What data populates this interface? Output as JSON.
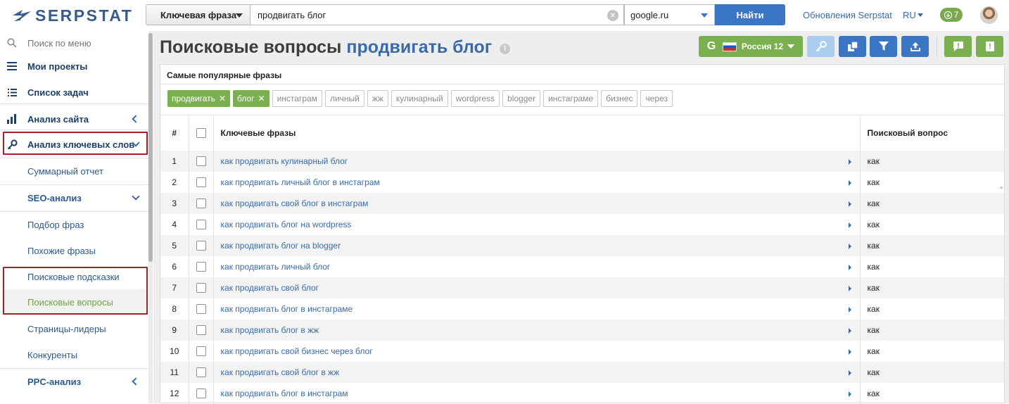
{
  "brand": {
    "name": "SERPSTAT"
  },
  "search": {
    "type_label": "Ключевая фраза",
    "query": "продвигать блог",
    "domain": "google.ru",
    "find_label": "Найти"
  },
  "header": {
    "updates_label": "Обновления Serpstat",
    "lang_label": "RU",
    "downloads_count": "7"
  },
  "sidebar": {
    "search_placeholder": "Поиск по меню",
    "items": [
      {
        "label": "Мои проекты"
      },
      {
        "label": "Список задач"
      },
      {
        "label": "Анализ сайта"
      },
      {
        "label": "Анализ ключевых слов"
      },
      {
        "label": "Суммарный отчет"
      },
      {
        "label": "SEO-анализ"
      },
      {
        "label": "Подбор фраз"
      },
      {
        "label": "Похожие фразы"
      },
      {
        "label": "Поисковые подсказки"
      },
      {
        "label": "Поисковые вопросы"
      },
      {
        "label": "Страницы-лидеры"
      },
      {
        "label": "Конкуренты"
      },
      {
        "label": "PPC-анализ"
      }
    ]
  },
  "page": {
    "title": "Поисковые вопросы",
    "keyword": "продвигать блог",
    "region_label": "Россия 12",
    "search_engine_letter": "G"
  },
  "panel": {
    "popular_title": "Самые популярные фразы",
    "chips_active": [
      "продвигать",
      "блог"
    ],
    "chips": [
      "инстаграм",
      "личный",
      "жж",
      "кулинарный",
      "wordpress",
      "blogger",
      "инстаграме",
      "бизнес",
      "через"
    ]
  },
  "table": {
    "headers": {
      "num": "#",
      "keywords": "Ключевые фразы",
      "question": "Поисковый вопрос"
    },
    "rows": [
      {
        "num": "1",
        "keyword": "как продвигать кулинарный блог",
        "question": "как"
      },
      {
        "num": "2",
        "keyword": "как продвигать личный блог в инстаграм",
        "question": "как"
      },
      {
        "num": "3",
        "keyword": "как продвигать свой блог в инстаграм",
        "question": "как"
      },
      {
        "num": "4",
        "keyword": "как продвигать блог на wordpress",
        "question": "как"
      },
      {
        "num": "5",
        "keyword": "как продвигать блог на blogger",
        "question": "как"
      },
      {
        "num": "6",
        "keyword": "как продвигать личный блог",
        "question": "как"
      },
      {
        "num": "7",
        "keyword": "как продвигать свой блог",
        "question": "как"
      },
      {
        "num": "8",
        "keyword": "как продвигать блог в инстаграме",
        "question": "как"
      },
      {
        "num": "9",
        "keyword": "как продвигать блог в жж",
        "question": "как"
      },
      {
        "num": "10",
        "keyword": "как продвигать свой бизнес через блог",
        "question": "как"
      },
      {
        "num": "11",
        "keyword": "как продвигать свой блог в жж",
        "question": "как"
      },
      {
        "num": "12",
        "keyword": "как продвигать блог в инстаграм",
        "question": "как"
      }
    ]
  },
  "colors": {
    "brand_blue": "#3a5b8c",
    "accent_blue": "#3a76c4",
    "green": "#7ab04f",
    "highlight_red": "#a4202b"
  }
}
